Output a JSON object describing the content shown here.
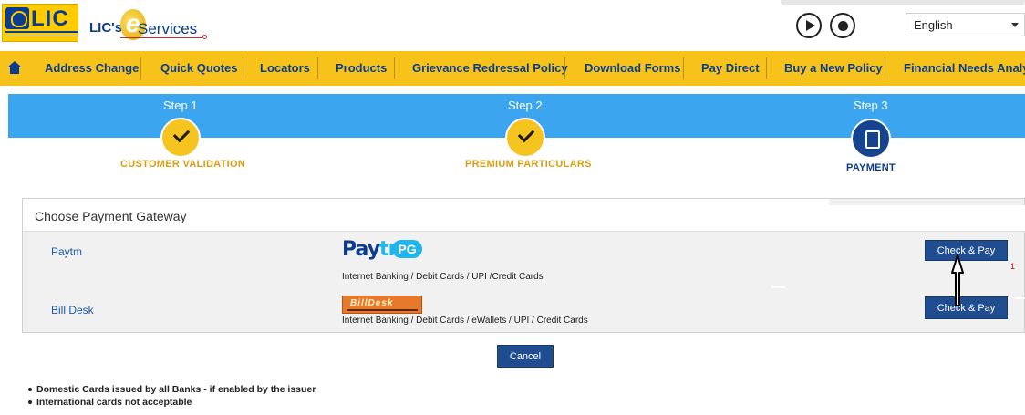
{
  "header": {
    "brand_logo": "LIC",
    "brand_eservices_prefix": "LIC's",
    "brand_eservices_e": "e",
    "brand_eservices_suffix": "Services",
    "language": "English"
  },
  "nav": {
    "items": [
      {
        "label": "Address Change"
      },
      {
        "label": "Quick Quotes"
      },
      {
        "label": "Locators"
      },
      {
        "label": "Products"
      },
      {
        "label": "Grievance Redressal Policy"
      },
      {
        "label": "Download Forms"
      },
      {
        "label": "Pay Direct"
      },
      {
        "label": "Buy a New Policy"
      },
      {
        "label": "Financial Needs Analys"
      }
    ]
  },
  "steps": [
    {
      "label": "Step 1",
      "caption": "CUSTOMER VALIDATION",
      "status": "done"
    },
    {
      "label": "Step 2",
      "caption": "PREMIUM PARTICULARS",
      "status": "done"
    },
    {
      "label": "Step 3",
      "caption": "PAYMENT",
      "status": "active"
    }
  ],
  "gateway": {
    "title": "Choose Payment Gateway",
    "options": [
      {
        "name": "Paytm",
        "logo_text_a": "Pay",
        "logo_text_b": "tm",
        "logo_badge": "PG",
        "description": "Internet Banking / Debit Cards / UPI /Credit Cards",
        "button": "Check & Pay"
      },
      {
        "name": "Bill Desk",
        "logo_text": "BillDesk",
        "description": "Internet Banking / Debit Cards / eWallets / UPI / Credit Cards",
        "button": "Check & Pay"
      }
    ]
  },
  "cancel_label": "Cancel",
  "notes": [
    "Domestic Cards issued by all Banks - if enabled by the issuer",
    "International cards not acceptable"
  ],
  "overlay_mark": "1",
  "colors": {
    "nav_bg": "#f7c21a",
    "nav_text": "#0a3d8f",
    "steps_band": "#3ba6ef",
    "step_done": "#f5c41e",
    "step_active": "#16438f",
    "button": "#1f4d8f"
  }
}
